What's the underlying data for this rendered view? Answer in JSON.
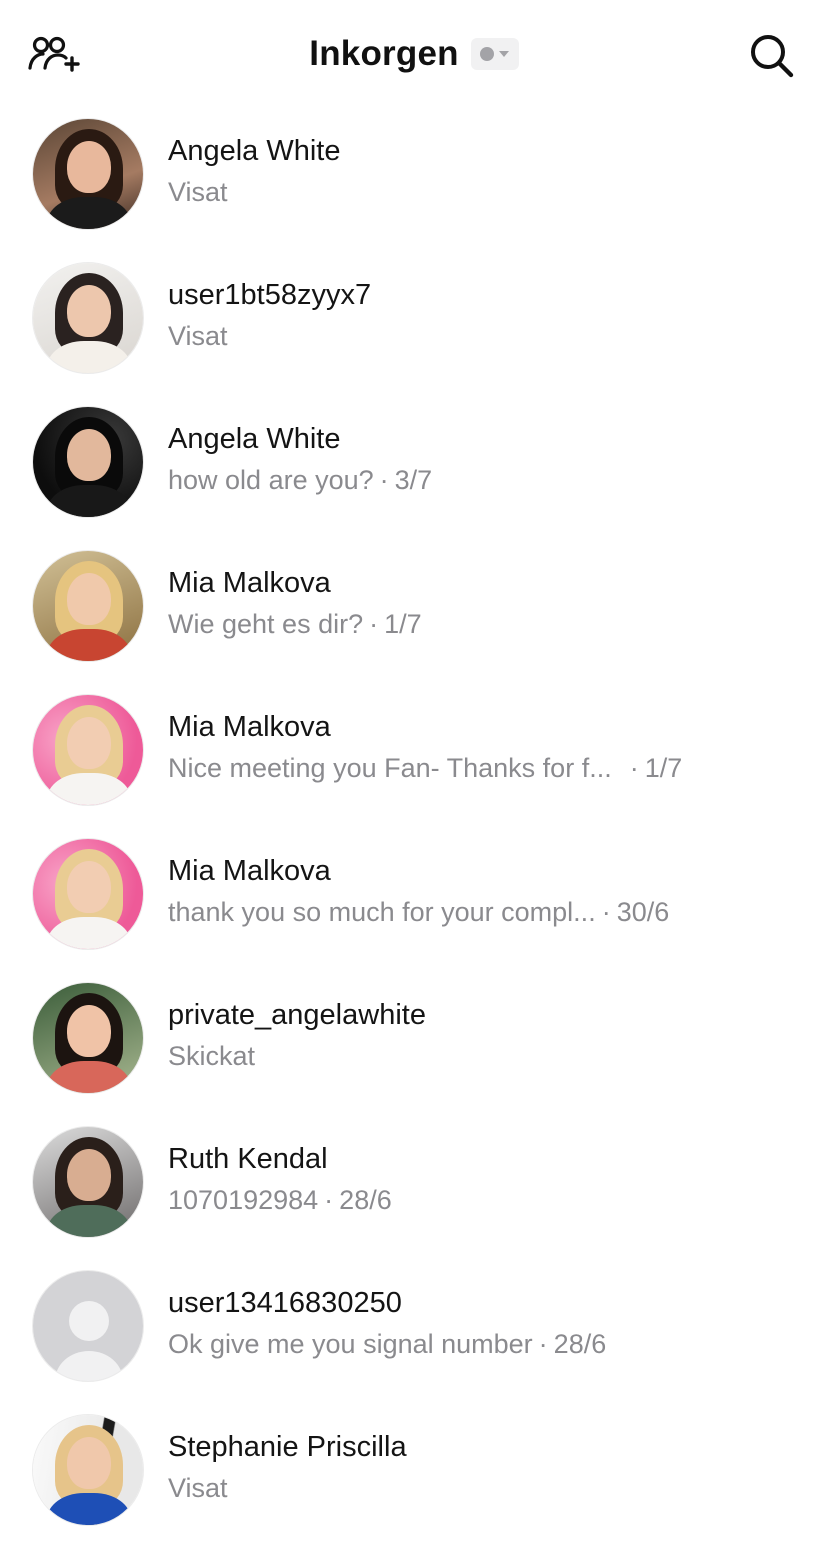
{
  "header": {
    "title": "Inkorgen",
    "left_icon": "add-friends-icon",
    "right_icon": "search-icon",
    "status_icon": "status-dot-dropdown-icon"
  },
  "conversations": [
    {
      "name": "Angela White",
      "message": "Visat",
      "date": ""
    },
    {
      "name": "user1bt58zyyx7",
      "message": "Visat",
      "date": ""
    },
    {
      "name": "Angela White",
      "message": "how old are you?",
      "date": "3/7"
    },
    {
      "name": "Mia Malkova",
      "message": "Wie geht es dir?",
      "date": "1/7"
    },
    {
      "name": "Mia Malkova",
      "message": "Nice meeting you Fan- Thanks for f...",
      "date": "1/7"
    },
    {
      "name": "Mia Malkova",
      "message": "thank you so much for your compl...",
      "date": "30/6"
    },
    {
      "name": "private_angelawhite",
      "message": "Skickat",
      "date": ""
    },
    {
      "name": "Ruth Kendal",
      "message": "1070192984",
      "date": "28/6"
    },
    {
      "name": "user13416830250",
      "message": "Ok give me you signal number",
      "date": "28/6"
    },
    {
      "name": "Stephanie Priscilla",
      "message": "Visat",
      "date": ""
    }
  ],
  "separator": "·",
  "colors": {
    "background": "#ffffff",
    "name_text": "#141414",
    "secondary_text": "#8a8a8e",
    "status_pill": "#f1f1f2"
  }
}
